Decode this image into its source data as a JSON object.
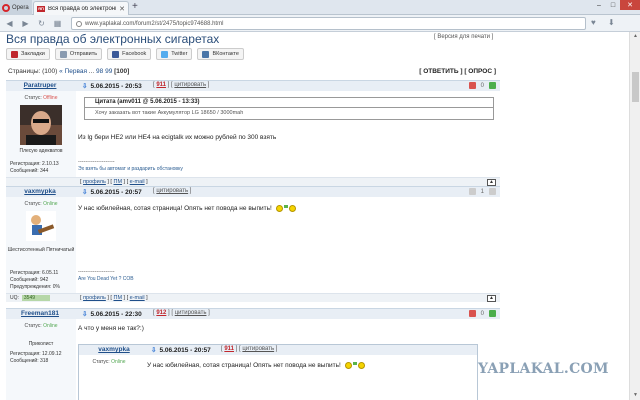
{
  "browser": {
    "opera_label": "Opera",
    "tab_favicon": "ЯП",
    "tab_title": "Вся правда об электронн...",
    "url": "www.yaplakal.com/forum2/st/2475/topic974688.html"
  },
  "topic": {
    "title": "Вся правда об электронных сигаретах",
    "print_link": "[ Версия для печати ]",
    "share": [
      "Закладки",
      "Отправить",
      "Facebook",
      "Twitter",
      "ВКонтакте"
    ],
    "pages_label": "Страницы:",
    "pages_count": "(100)",
    "pages_first": "« Первая",
    "pages_ellipsis": "...",
    "pages_nums": [
      "98",
      "99"
    ],
    "pages_current": "[100]",
    "actions": "[ ОТВЕТИТЬ ] [ ОПРОС ]"
  },
  "posts": [
    {
      "author": "Paratruper",
      "date": "5.06.2015 - 20:53",
      "num": "911",
      "cite": "цитировать",
      "rating": "0",
      "status_label": "Статус:",
      "status": "Offline",
      "avatar_caption": "Плесую адекватов",
      "reg": "Регистрация: 2.10.13",
      "msgs": "Сообщений: 344",
      "quote_head": "Цитата (amv011 @ 5.06.2015 - 13:33)",
      "quote_body": "Хочу заказать вот такие Аккумулятор LG 18650 / 3000mah",
      "text": "Из lg бери HE2 или HE4 на ecigtalk их можно рублей по 300 взять",
      "sig_line": "--------------------",
      "sig": "Эх взять бы автомат и раздарить обстановку",
      "foot": [
        "профиль",
        "ПМ",
        "e-mail"
      ]
    },
    {
      "author": "vaxmypka",
      "date": "5.06.2015 - 20:57",
      "cite": "цитировать",
      "rating": "1",
      "status_label": "Статус:",
      "status": "Online",
      "avatar_caption": "Шестисотенный Пятничатый",
      "reg": "Регистрация: 6.05.11",
      "msgs": "Сообщений: 942",
      "warn": "Предупреждения: 0%",
      "text": "У нас юбилейная, сотая страница! Опять нет повода не выпить!",
      "sig_line": "--------------------",
      "sig": "Are You Dead Yet ? COB",
      "uq_label": "UQ:",
      "uq_value": "3549",
      "foot": [
        "профиль",
        "ПМ",
        "e-mail"
      ]
    },
    {
      "author": "Freeman181",
      "date": "5.06.2015 - 22:30",
      "num": "912",
      "cite": "цитировать",
      "rating": "0",
      "status_label": "Статус:",
      "status": "Online",
      "avatar_caption": "Приколист",
      "reg": "Регистрация: 12.09.12",
      "msgs": "Сообщений: 318",
      "text": "А что у меня не так?:)",
      "nested": {
        "author": "vaxmypka",
        "date": "5.06.2015 - 20:57",
        "num": "911",
        "cite": "цитировать",
        "status_label": "Статус:",
        "status": "Online",
        "text": "У нас юбилейная, сотая страница! Опять нет повода не выпить!"
      }
    }
  ],
  "watermark": "YAPLAKAL.COM"
}
